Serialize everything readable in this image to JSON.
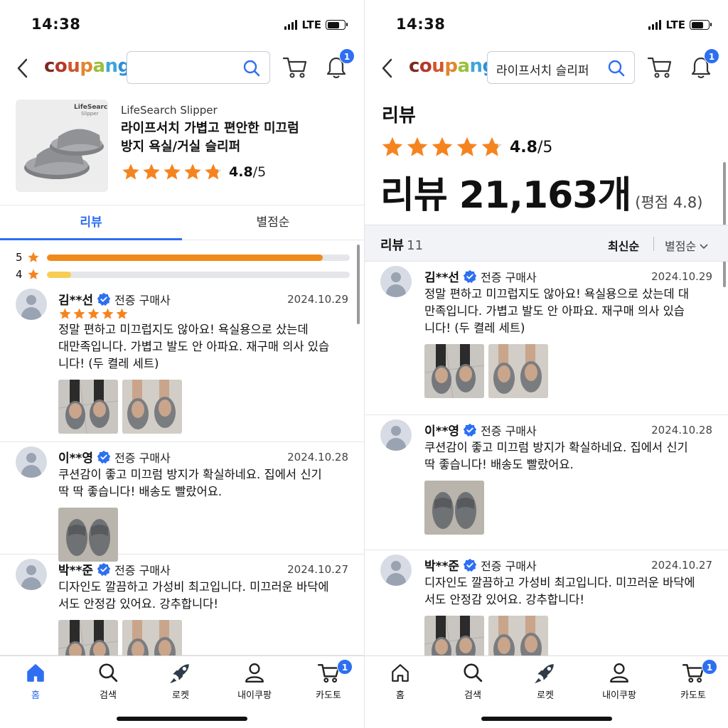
{
  "status": {
    "time": "14:38",
    "network": "LTE"
  },
  "header": {
    "logo": "coupang",
    "search_query": "라이프서치 슬리퍼",
    "notification_count": "1"
  },
  "colors": {
    "accent": "#2e6ff2",
    "star": "#f5841f",
    "bar_5": "#f08a1a",
    "bar_4": "#f7cd55"
  },
  "product": {
    "brand_en": "LifeSearch Slipper",
    "thumb_brand": "LifeSearch",
    "thumb_sub": "Slipper",
    "name_line1": "라이프서치 가볍고 편안한 미끄럼",
    "name_line2": "방지 욕실/거실 슬리퍼",
    "rating": "4.8",
    "rating_outof": "/5"
  },
  "tabs": [
    {
      "label": "리뷰",
      "active": true
    },
    {
      "label": "별점순",
      "active": false
    }
  ],
  "distribution": [
    {
      "star": "5",
      "fraction": 0.91
    },
    {
      "star": "4",
      "fraction": 0.08
    }
  ],
  "right_panel": {
    "section_title": "리뷰",
    "rating": "4.8",
    "rating_outof": "/5",
    "big_count": "리뷰 21,163개",
    "rating_note": "(평점 4.8)",
    "list_label": "리뷰",
    "list_count": "11",
    "sort_latest": "최신순",
    "sort_rating": "별점순"
  },
  "reviews": [
    {
      "name": "김**선",
      "verified": "전증 구매사",
      "date": "2024.10.29",
      "stars": 5,
      "text_left": [
        "정말 편하고 미끄럽지도 않아요! 욕실용으로 샀는데",
        "대만족입니다. 가볍고 발도 안 아파요. 재구매 의사 있습",
        "니다! (두 켤레 세트)"
      ],
      "text_right": [
        "정말 편하고 미끄럽지도 않아요! 욕실용으로 샀는데 대",
        "만족입니다. 가볍고 발도 안 아파요. 재구매 의사 있습",
        "니다! (두 켤레 세트)"
      ],
      "photos": 2
    },
    {
      "name": "이**영",
      "verified": "전증 구매사",
      "date": "2024.10.28",
      "stars": 0,
      "text_left": [
        "쿠션감이 좋고 미끄럼 방지가 확실하네요. 집에서 신기",
        "딱 딱 좋습니다! 배송도 빨랐어요."
      ],
      "text_right": [
        "쿠션감이 좋고 미끄럼 방지가 확실하네요. 집에서 신기",
        "딱 좋습니다! 배송도 빨랐어요."
      ],
      "photos": 1
    },
    {
      "name": "박**준",
      "verified": "전증 구매사",
      "date": "2024.10.27",
      "stars": 0,
      "text_left": [
        "디자인도 깔끔하고 가성비 최고입니다. 미끄러운 바닥에",
        "서도 안정감 있어요. 강추합니다!"
      ],
      "text_right": [
        "디자인도 깔끔하고 가성비 최고입니다. 미끄러운 바닥에",
        "서도 안정감 있어요. 강추합니다!"
      ],
      "photos": 2
    }
  ],
  "nav": [
    {
      "label": "홈",
      "icon": "home-icon"
    },
    {
      "label": "검색",
      "icon": "search-icon"
    },
    {
      "label": "로켓",
      "icon": "rocket-icon"
    },
    {
      "label": "내이쿠팡",
      "icon": "user-icon"
    },
    {
      "label": "카도토",
      "icon": "cart-icon",
      "badge": "1"
    }
  ]
}
